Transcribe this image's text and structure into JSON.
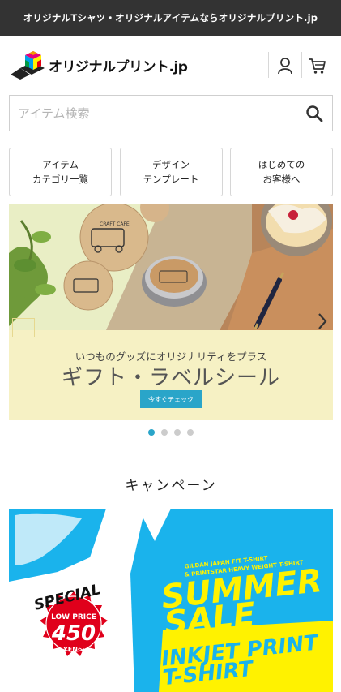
{
  "topbar": {
    "text": "オリジナルTシャツ・オリジナルアイテムならオリジナルプリント.jp"
  },
  "header": {
    "logo_text": "オリジナルプリント.jp",
    "icons": [
      "user-icon",
      "cart-icon"
    ]
  },
  "search": {
    "placeholder": "アイテム検索",
    "value": ""
  },
  "nav": [
    {
      "line1": "アイテム",
      "line2": "カテゴリ一覧"
    },
    {
      "line1": "デザイン",
      "line2": "テンプレート"
    },
    {
      "line1": "はじめての",
      "line2": "お客様へ"
    }
  ],
  "slider": {
    "subtitle": "いつものグッズにオリジナリティをプラス",
    "title": "ギフト・ラベルシール",
    "button": "今すぐチェック",
    "sticker_text": "CRAFT CAFE",
    "dots": 4,
    "active_dot": 0
  },
  "campaign": {
    "heading": "キャンペーン",
    "banner": {
      "special": "SPECIAL",
      "low_price": "LOW PRICE",
      "price": "450",
      "yen": "YEN〜",
      "subline1": "GILDAN JAPAN FIT T-SHIRT",
      "subline2": "& PRINTSTAR HEAVY WEIGHT T-SHIRT",
      "summer": "SUMMER",
      "sale": "SALE",
      "inkjet": "INKJET PRINT",
      "tshirt": "T-SHIRT"
    }
  },
  "colors": {
    "accent": "#2aa5c9",
    "topbar": "#333333",
    "caption_bg": "#f6f1c4",
    "banner_blue": "#1ab3ec",
    "banner_yellow": "#fff200",
    "badge_red": "#e0001b"
  }
}
